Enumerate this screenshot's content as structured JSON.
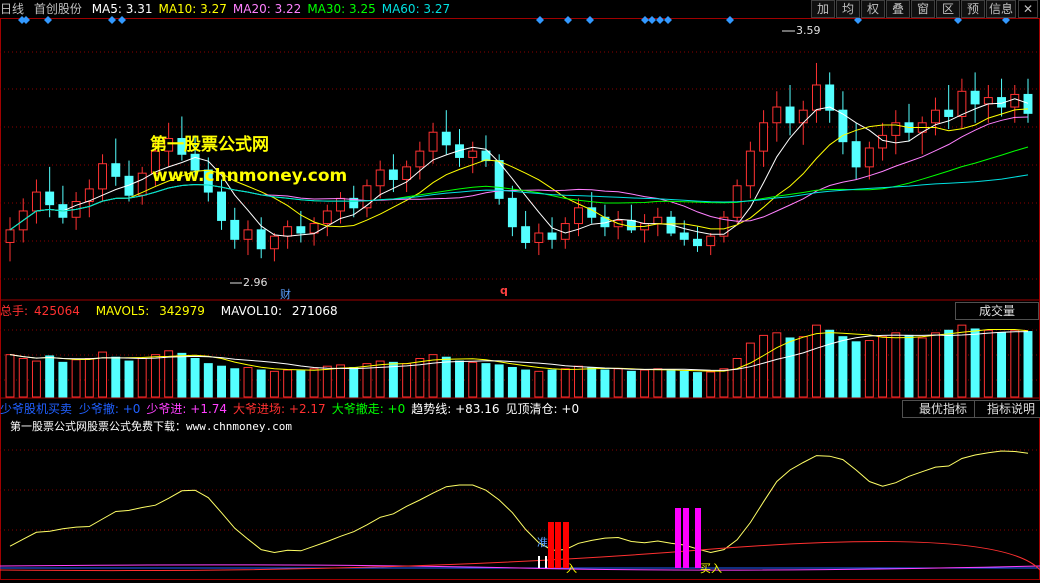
{
  "header": {
    "period": "日线",
    "stock_name": "首创股份",
    "ma": [
      {
        "label": "MA5:",
        "value": "3.31",
        "color": "#ffffff"
      },
      {
        "label": "MA10:",
        "value": "3.27",
        "color": "#ffff00"
      },
      {
        "label": "MA20:",
        "value": "3.22",
        "color": "#ff80ff"
      },
      {
        "label": "MA30:",
        "value": "3.25",
        "color": "#00ff00"
      },
      {
        "label": "MA60:",
        "value": "3.27",
        "color": "#00e0e0"
      }
    ],
    "nav_buttons": [
      "加",
      "均",
      "权",
      "叠",
      "窗",
      "区",
      "预",
      "信息"
    ],
    "close_label": "✕"
  },
  "volume_panel": {
    "total_label": "总手:",
    "total_value": "425064",
    "mavol5_label": "MAVOL5:",
    "mavol5_value": "342979",
    "mavol10_label": "MAVOL10:",
    "mavol10_value": "271068",
    "button": "成交量"
  },
  "indicator_panel": {
    "name": "少爷股机买卖",
    "items": [
      {
        "label": "少爷撤:",
        "value": "+0",
        "color": "#2060ff"
      },
      {
        "label": "少爷进:",
        "value": "+1.74",
        "color": "#ff40ff"
      },
      {
        "label": "大爷进场:",
        "value": "+2.17",
        "color": "#ff3030"
      },
      {
        "label": "大爷撤走:",
        "value": "+0",
        "color": "#00ff00"
      },
      {
        "label": "趋势线:",
        "value": "+83.16",
        "color": "#ffffff"
      },
      {
        "label": "见顶清仓:",
        "value": "+0",
        "color": "#ffffff"
      }
    ],
    "btn_best": "最优指标",
    "btn_help": "指标说明",
    "ad_text": "第一股票公式网股票公式免费下载：www.chnmoney.com",
    "signal_labels": [
      "准",
      "入",
      "买入"
    ]
  },
  "watermark": {
    "line1": "第一股票公式网",
    "line2": "www.chnmoney.com"
  },
  "price_annotations": {
    "high": "3.59",
    "low": "2.96",
    "marker_cai": "财",
    "marker_q": "q"
  },
  "colors": {
    "up": "#ff3232",
    "down": "#54ffff",
    "ma5": "#ffffff",
    "ma10": "#ffff00",
    "ma20": "#ff80ff",
    "ma30": "#00ff00",
    "ma60": "#00e0e0",
    "grid": "#8b0000",
    "diamond": "#3399ff"
  },
  "chart_data": {
    "type": "candlestick",
    "price_range": [
      2.85,
      3.72
    ],
    "candles": [
      [
        3.02,
        3.1,
        2.96,
        3.06
      ],
      [
        3.06,
        3.16,
        3.02,
        3.12
      ],
      [
        3.12,
        3.22,
        3.08,
        3.18
      ],
      [
        3.18,
        3.26,
        3.1,
        3.14
      ],
      [
        3.14,
        3.2,
        3.08,
        3.1
      ],
      [
        3.1,
        3.18,
        3.06,
        3.15
      ],
      [
        3.15,
        3.22,
        3.1,
        3.19
      ],
      [
        3.19,
        3.3,
        3.15,
        3.27
      ],
      [
        3.27,
        3.35,
        3.2,
        3.23
      ],
      [
        3.23,
        3.28,
        3.15,
        3.17
      ],
      [
        3.17,
        3.26,
        3.14,
        3.24
      ],
      [
        3.24,
        3.34,
        3.2,
        3.31
      ],
      [
        3.31,
        3.4,
        3.26,
        3.35
      ],
      [
        3.35,
        3.42,
        3.28,
        3.3
      ],
      [
        3.3,
        3.36,
        3.22,
        3.25
      ],
      [
        3.25,
        3.29,
        3.15,
        3.18
      ],
      [
        3.18,
        3.22,
        3.06,
        3.09
      ],
      [
        3.09,
        3.13,
        3.0,
        3.03
      ],
      [
        3.03,
        3.09,
        2.98,
        3.06
      ],
      [
        3.06,
        3.1,
        2.97,
        3.0
      ],
      [
        3.0,
        3.05,
        2.96,
        3.04
      ],
      [
        3.04,
        3.09,
        3.0,
        3.07
      ],
      [
        3.07,
        3.12,
        3.02,
        3.05
      ],
      [
        3.05,
        3.1,
        3.01,
        3.08
      ],
      [
        3.08,
        3.14,
        3.04,
        3.12
      ],
      [
        3.12,
        3.18,
        3.08,
        3.16
      ],
      [
        3.16,
        3.2,
        3.1,
        3.13
      ],
      [
        3.13,
        3.22,
        3.1,
        3.2
      ],
      [
        3.2,
        3.28,
        3.16,
        3.25
      ],
      [
        3.25,
        3.3,
        3.18,
        3.22
      ],
      [
        3.22,
        3.28,
        3.18,
        3.26
      ],
      [
        3.26,
        3.34,
        3.22,
        3.31
      ],
      [
        3.31,
        3.4,
        3.27,
        3.37
      ],
      [
        3.37,
        3.44,
        3.3,
        3.33
      ],
      [
        3.33,
        3.38,
        3.26,
        3.29
      ],
      [
        3.29,
        3.34,
        3.24,
        3.31
      ],
      [
        3.31,
        3.36,
        3.26,
        3.28
      ],
      [
        3.28,
        3.3,
        3.14,
        3.16
      ],
      [
        3.16,
        3.2,
        3.04,
        3.07
      ],
      [
        3.07,
        3.12,
        3.0,
        3.02
      ],
      [
        3.02,
        3.08,
        2.98,
        3.05
      ],
      [
        3.05,
        3.1,
        3.0,
        3.03
      ],
      [
        3.03,
        3.1,
        3.0,
        3.08
      ],
      [
        3.08,
        3.16,
        3.04,
        3.13
      ],
      [
        3.13,
        3.18,
        3.08,
        3.1
      ],
      [
        3.1,
        3.14,
        3.04,
        3.07
      ],
      [
        3.07,
        3.12,
        3.03,
        3.09
      ],
      [
        3.09,
        3.14,
        3.05,
        3.06
      ],
      [
        3.06,
        3.11,
        3.02,
        3.08
      ],
      [
        3.08,
        3.13,
        3.04,
        3.1
      ],
      [
        3.1,
        3.12,
        3.04,
        3.05
      ],
      [
        3.05,
        3.09,
        3.01,
        3.03
      ],
      [
        3.03,
        3.07,
        2.99,
        3.01
      ],
      [
        3.01,
        3.05,
        2.98,
        3.04
      ],
      [
        3.04,
        3.12,
        3.02,
        3.1
      ],
      [
        3.1,
        3.22,
        3.08,
        3.2
      ],
      [
        3.2,
        3.34,
        3.16,
        3.31
      ],
      [
        3.31,
        3.44,
        3.26,
        3.4
      ],
      [
        3.4,
        3.5,
        3.34,
        3.45
      ],
      [
        3.45,
        3.52,
        3.36,
        3.4
      ],
      [
        3.4,
        3.47,
        3.33,
        3.44
      ],
      [
        3.44,
        3.59,
        3.4,
        3.52
      ],
      [
        3.52,
        3.56,
        3.4,
        3.44
      ],
      [
        3.44,
        3.5,
        3.3,
        3.34
      ],
      [
        3.34,
        3.4,
        3.22,
        3.26
      ],
      [
        3.26,
        3.34,
        3.22,
        3.32
      ],
      [
        3.32,
        3.4,
        3.28,
        3.36
      ],
      [
        3.36,
        3.44,
        3.3,
        3.4
      ],
      [
        3.4,
        3.46,
        3.34,
        3.37
      ],
      [
        3.37,
        3.42,
        3.3,
        3.4
      ],
      [
        3.4,
        3.48,
        3.36,
        3.44
      ],
      [
        3.44,
        3.52,
        3.38,
        3.42
      ],
      [
        3.42,
        3.54,
        3.38,
        3.5
      ],
      [
        3.5,
        3.56,
        3.4,
        3.46
      ],
      [
        3.46,
        3.52,
        3.4,
        3.48
      ],
      [
        3.48,
        3.54,
        3.42,
        3.45
      ],
      [
        3.45,
        3.52,
        3.4,
        3.49
      ],
      [
        3.49,
        3.54,
        3.4,
        3.43
      ]
    ],
    "volumes": [
      330,
      300,
      280,
      320,
      270,
      290,
      300,
      350,
      310,
      280,
      300,
      330,
      360,
      340,
      300,
      260,
      240,
      220,
      230,
      210,
      200,
      210,
      205,
      220,
      240,
      250,
      230,
      260,
      280,
      270,
      260,
      300,
      330,
      310,
      280,
      270,
      260,
      250,
      230,
      210,
      200,
      210,
      220,
      240,
      230,
      210,
      220,
      200,
      210,
      220,
      205,
      200,
      190,
      195,
      220,
      300,
      420,
      480,
      500,
      460,
      470,
      560,
      520,
      470,
      430,
      440,
      470,
      500,
      480,
      460,
      500,
      520,
      560,
      530,
      520,
      500,
      520,
      510
    ],
    "volume_range": [
      0,
      600
    ]
  }
}
